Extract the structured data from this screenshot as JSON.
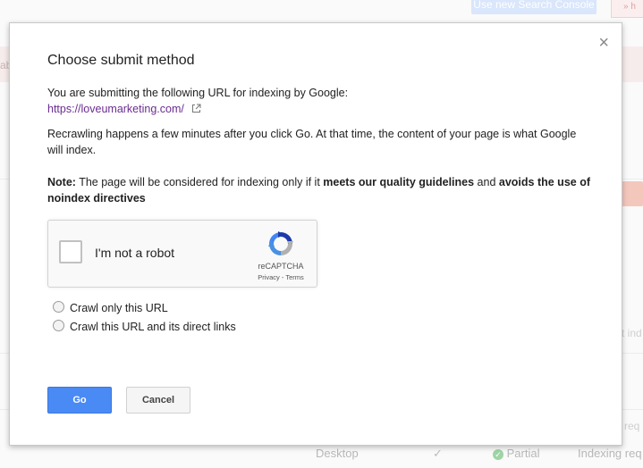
{
  "background": {
    "top_button": "Use new Search Console",
    "top_right_badge": "» h",
    "left_fragment": "ab",
    "right_fragment": "t ind",
    "bottom": {
      "device": "Desktop",
      "status": "Partial",
      "action1": "Indexing req",
      "action2": "Indexing requ",
      "right_edge": "req"
    }
  },
  "dialog": {
    "title": "Choose submit method",
    "intro": "You are submitting the following URL for indexing by Google:",
    "url": "https://loveumarketing.com/",
    "paragraph": "Recrawling happens a few minutes after you click Go. At that time, the content of your page is what Google will index.",
    "note": {
      "label": "Note:",
      "text1": " The page will be considered for indexing only if it ",
      "bold1": "meets our quality guidelines",
      "text2": " and ",
      "bold2": "avoids the use of noindex directives"
    },
    "captcha": {
      "label": "I'm not a robot",
      "brand": "reCAPTCHA",
      "links": "Privacy - Terms"
    },
    "options": [
      "Crawl only this URL",
      "Crawl this URL and its direct links"
    ],
    "go_label": "Go",
    "cancel_label": "Cancel",
    "close_glyph": "×"
  }
}
